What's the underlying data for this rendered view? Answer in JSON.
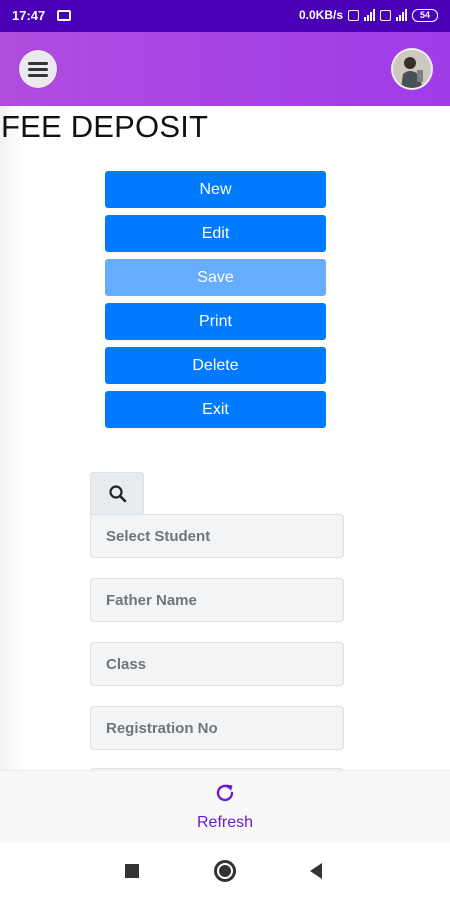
{
  "status_bar": {
    "time": "17:47",
    "net_speed": "0.0KB/s",
    "battery": "54"
  },
  "page": {
    "title": "FEE DEPOSIT"
  },
  "actions": {
    "new": "New",
    "edit": "Edit",
    "save": "Save",
    "print": "Print",
    "delete": "Delete",
    "exit": "Exit"
  },
  "form": {
    "student_placeholder": "Select Student",
    "father_placeholder": "Father Name",
    "class_placeholder": "Class",
    "registration_placeholder": "Registration No"
  },
  "bottom": {
    "refresh_label": "Refresh"
  },
  "colors": {
    "primary": "#007bff",
    "primary_disabled": "#66adff",
    "appbar": "#a03be8",
    "statusbar": "#4a00b6",
    "accent_text": "#6a1bd6"
  }
}
